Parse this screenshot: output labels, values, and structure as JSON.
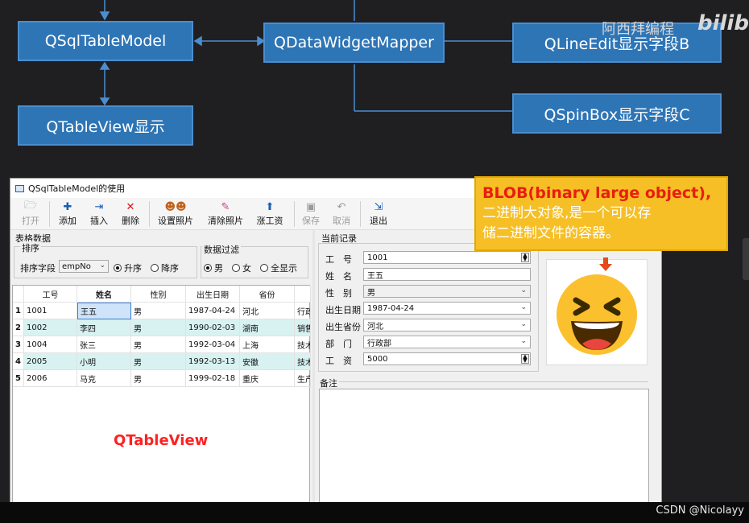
{
  "diagram": {
    "model": "QSqlTableModel",
    "mapper": "QDataWidgetMapper",
    "tableview": "QTableView显示",
    "lineedit": "QLineEdit显示字段B",
    "spinbox": "QSpinBox显示字段C"
  },
  "watermark": {
    "text": "阿西拜编程",
    "logo": "bilibili"
  },
  "window": {
    "title": "QSqlTableModel的使用"
  },
  "toolbar": {
    "open": "打开",
    "add": "添加",
    "insert": "插入",
    "delete": "删除",
    "set_photo": "设置照片",
    "clear_photo": "清除照片",
    "raise_salary": "涨工资",
    "save": "保存",
    "cancel": "取消",
    "exit": "退出"
  },
  "left": {
    "group_title": "表格数据",
    "sort_title": "排序",
    "sort_field_label": "排序字段",
    "sort_field_value": "empNo",
    "asc": "升序",
    "desc": "降序",
    "filter_title": "数据过滤",
    "male": "男",
    "female": "女",
    "all": "全显示"
  },
  "table": {
    "headers": [
      "工号",
      "姓名",
      "性别",
      "出生日期",
      "省份",
      ""
    ],
    "rows": [
      {
        "n": "1",
        "id": "1001",
        "name": "王五",
        "sex": "男",
        "birth": "1987-04-24",
        "prov": "河北",
        "dept": "行政"
      },
      {
        "n": "2",
        "id": "1002",
        "name": "李四",
        "sex": "男",
        "birth": "1990-02-03",
        "prov": "湖南",
        "dept": "销售"
      },
      {
        "n": "3",
        "id": "1004",
        "name": "张三",
        "sex": "男",
        "birth": "1992-03-04",
        "prov": "上海",
        "dept": "技术"
      },
      {
        "n": "4",
        "id": "2005",
        "name": "小明",
        "sex": "男",
        "birth": "1992-03-13",
        "prov": "安徽",
        "dept": "技术"
      },
      {
        "n": "5",
        "id": "2006",
        "name": "马克",
        "sex": "男",
        "birth": "1999-02-18",
        "prov": "重庆",
        "dept": "生产"
      }
    ],
    "overlay_label": "QTableView"
  },
  "record": {
    "title": "当前记录",
    "labels": [
      "工　号",
      "姓　名",
      "性　别",
      "出生日期",
      "出生省份",
      "部　门",
      "工　资"
    ],
    "empno": "1001",
    "name": "王五",
    "sex": "男",
    "birth": "1987-04-24",
    "province": "河北",
    "dept": "行政部",
    "salary": "5000",
    "memo_label": "备注"
  },
  "note": {
    "line1": "BLOB(binary large object),",
    "line2": "二进制大对象,是一个可以存",
    "line3": "储二进制文件的容器。"
  },
  "footer": {
    "credit": "CSDN @Nicolayy"
  },
  "colors": {
    "box": "#2e75b6",
    "note_bg": "#f6bf26",
    "note_title": "#e81e0e",
    "row_alt": "#d8f2f2"
  }
}
